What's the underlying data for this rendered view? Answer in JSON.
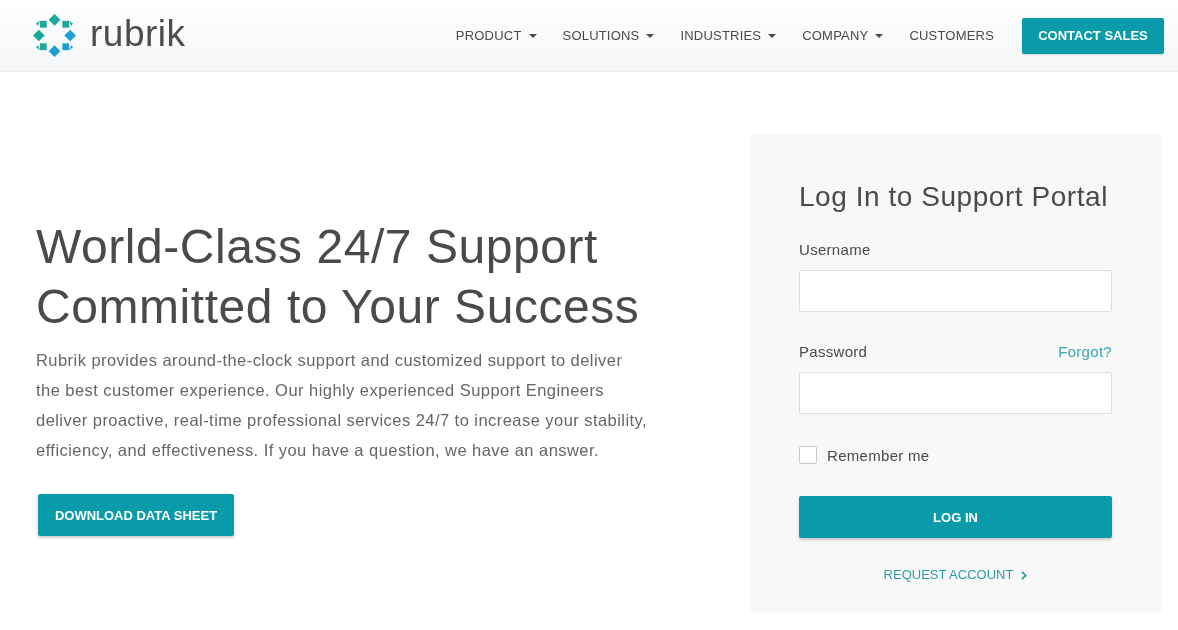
{
  "header": {
    "logo": {
      "text": "rubrik"
    },
    "nav": [
      {
        "label": "PRODUCT",
        "dropdown": true
      },
      {
        "label": "SOLUTIONS",
        "dropdown": true
      },
      {
        "label": "INDUSTRIES",
        "dropdown": true
      },
      {
        "label": "COMPANY",
        "dropdown": true
      },
      {
        "label": "CUSTOMERS",
        "dropdown": false
      }
    ],
    "cta": "CONTACT SALES"
  },
  "hero": {
    "title": "World-Class 24/7 Support Committed to Your Success",
    "body": "Rubrik provides around-the-clock support and customized support to deliver the best customer experience. Our highly experienced Support Engineers deliver proactive, real-time professional services 24/7 to increase your stability, efficiency, and effectiveness. If you have a question, we have an answer.",
    "button": "DOWNLOAD DATA SHEET"
  },
  "login": {
    "title": "Log In to Support Portal",
    "fields": [
      {
        "label": "Username"
      },
      {
        "label": "Password",
        "link": "Forgot?"
      }
    ],
    "remember": {
      "label": "Remember me",
      "checked": false
    },
    "submit": "LOG IN",
    "request_link": "REQUEST ACCOUNT"
  }
}
